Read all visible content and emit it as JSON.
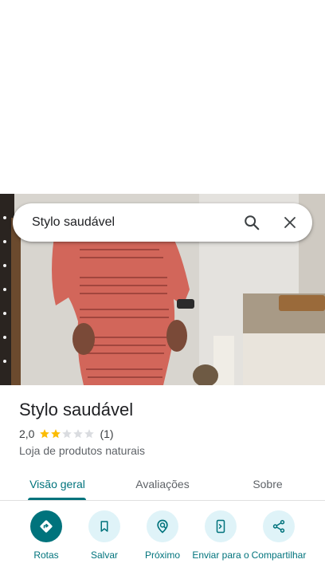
{
  "search": {
    "query": "Stylo saudável"
  },
  "place": {
    "name": "Stylo saudável",
    "rating": "2,0",
    "rating_value": 2,
    "rating_max": 5,
    "review_count": "(1)",
    "category": "Loja de produtos naturais"
  },
  "tabs": [
    {
      "label": "Visão geral",
      "active": true
    },
    {
      "label": "Avaliações",
      "active": false
    },
    {
      "label": "Sobre",
      "active": false
    }
  ],
  "actions": [
    {
      "label": "Rotas",
      "icon": "directions-icon"
    },
    {
      "label": "Salvar",
      "icon": "bookmark-icon"
    },
    {
      "label": "Próximo",
      "icon": "nearby-icon"
    },
    {
      "label": "Enviar para o",
      "icon": "send-to-phone-icon"
    },
    {
      "label": "Compartilhar",
      "icon": "share-icon"
    }
  ],
  "colors": {
    "accent": "#00737c",
    "star": "#fbbc04",
    "chip": "#dff3f8"
  }
}
